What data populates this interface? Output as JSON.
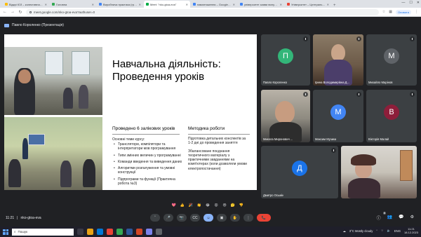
{
  "browser": {
    "tabs": [
      {
        "label": "Відкрі ЮЗ – колективна Бюджет…",
        "color": "#fbbc04",
        "active": false
      },
      {
        "label": "Головна",
        "color": "#34a853",
        "active": false
      },
      {
        "label": "Виробнича практика (група...",
        "color": "#4285f4",
        "active": false
      },
      {
        "label": "Meet: \"nko-gtoa-eva\"",
        "color": "#00ac47",
        "active": true
      },
      {
        "label": "навантаження – Google Д...",
        "color": "#4285f4",
        "active": false
      },
      {
        "label": "університет заяви вилучити ...",
        "color": "#4285f4",
        "active": false
      },
      {
        "label": "Університет – Центральну д...",
        "color": "#ea4335",
        "active": false
      }
    ],
    "url": "meet.google.com/nko-gtoa-eva?authuser=0",
    "profile_label": "Оновити"
  },
  "meet": {
    "presenter_label": "Павло Короленко (Презентація)",
    "meeting_time": "11:21",
    "meeting_code": "nko-gtoa-eva",
    "participants_count": "8",
    "reactions": [
      "💖",
      "👍",
      "🎉",
      "👏",
      "😂",
      "😮",
      "😢",
      "🤔",
      "👎"
    ],
    "controls": {
      "hand": "✋",
      "mic": "🎤",
      "cam": "📷",
      "cc": "CC",
      "emoji": "☺",
      "present": "▣",
      "more": "⋮",
      "end": "📞"
    },
    "side_controls": {
      "info": "ⓘ",
      "people": "👥",
      "chat": "💬",
      "activities": "⚙"
    }
  },
  "slide": {
    "title_line1": "Навчальна діяльність:",
    "title_line2": "Проведення уроків",
    "left_heading": "Проведено 6 залікових уроків",
    "right_heading": "Методика роботи",
    "topics_label": "Основні теми курсу:",
    "bullets": [
      "Транслятори, компілятори та інтерпретатори мов програмування",
      "Типи змінних величин у програмуванні",
      "Команди введення та виведення даних",
      "Алгоритми розгалуження та умовні конструкції",
      "Підпрограми та функції (Практична робота №3)"
    ],
    "right_p1": "Підготовка детальних конспектів за 1-2 дні до проведення заняття",
    "right_p2": "Збалансоване поєднання теоретичного матеріалу з практичними завданнями на комп'ютерах (коли дозволяли умови електропостачання)"
  },
  "tiles": [
    {
      "name": "Павло Короленко",
      "initial": "П",
      "color": "#33b679"
    },
    {
      "name": "Ірина Володимирівна Д...",
      "initial": "",
      "color": ""
    },
    {
      "name": "Михайло Марінов",
      "initial": "М",
      "color": "#5f6368"
    },
    {
      "name": "Микола Миронович ...",
      "initial": "",
      "color": ""
    },
    {
      "name": "Максим Музика",
      "initial": "М",
      "color": "#4285f4"
    },
    {
      "name": "Вікторія Малай",
      "initial": "В",
      "color": "#8d1e3a"
    },
    {
      "name": "Дмитро Осьмін",
      "initial": "Д",
      "color": "#1a73e8"
    }
  ],
  "taskbar": {
    "search_placeholder": "Пошук",
    "weather": "3°C  Mostly cloudy",
    "lang": "ENG",
    "time": "11:21",
    "date": "18.12.2023"
  }
}
